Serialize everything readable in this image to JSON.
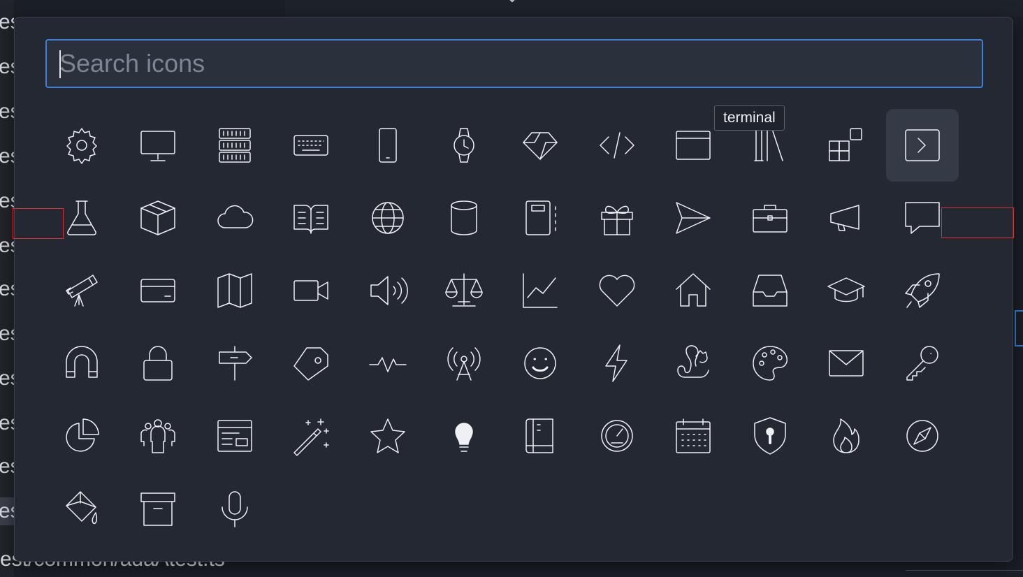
{
  "background": {
    "row_fragment": "es",
    "row_count": 12,
    "bottom_path": "est/common/adaAtest.ts"
  },
  "search": {
    "placeholder": "Search icons",
    "value": ""
  },
  "tooltip": {
    "text": "terminal"
  },
  "icons": [
    "gear-icon",
    "device-desktop-icon",
    "server-icon",
    "keyboard-icon",
    "device-mobile-icon",
    "watch-icon",
    "ruby-icon",
    "code-icon",
    "browser-icon",
    "library-icon",
    "apps-icon",
    "terminal-icon",
    "beaker-icon",
    "package-icon",
    "cloud-icon",
    "book-icon",
    "globe-icon",
    "database-icon",
    "notebook-icon",
    "gift-icon",
    "paper-airplane-icon",
    "briefcase-icon",
    "megaphone-icon",
    "comment-icon",
    "telescope-icon",
    "credit-card-icon",
    "map-icon",
    "device-camera-video-icon",
    "unmute-icon",
    "law-icon",
    "graph-icon",
    "heart-icon",
    "home-icon",
    "inbox-icon",
    "mortar-board-icon",
    "rocket-icon",
    "magnet-icon",
    "lock-icon",
    "milestone-icon",
    "tag-icon",
    "pulse-icon",
    "broadcast-icon",
    "smiley-icon",
    "zap-icon",
    "squirrel-icon",
    "palette-icon",
    "mail-icon",
    "key-icon",
    "pie-chart-icon",
    "organization-icon",
    "project-icon",
    "wand-icon",
    "star-icon",
    "light-bulb-icon",
    "repo-icon",
    "dashboard-icon",
    "calendar-icon",
    "shield-lock-icon",
    "flame-icon",
    "compass-icon",
    "paintbrush-icon",
    "archive-icon",
    "microphone-icon"
  ],
  "active_icon": "terminal-icon",
  "colors": {
    "accent": "#3f7fd8",
    "panel": "#232833",
    "icon": "#eef0f3"
  }
}
